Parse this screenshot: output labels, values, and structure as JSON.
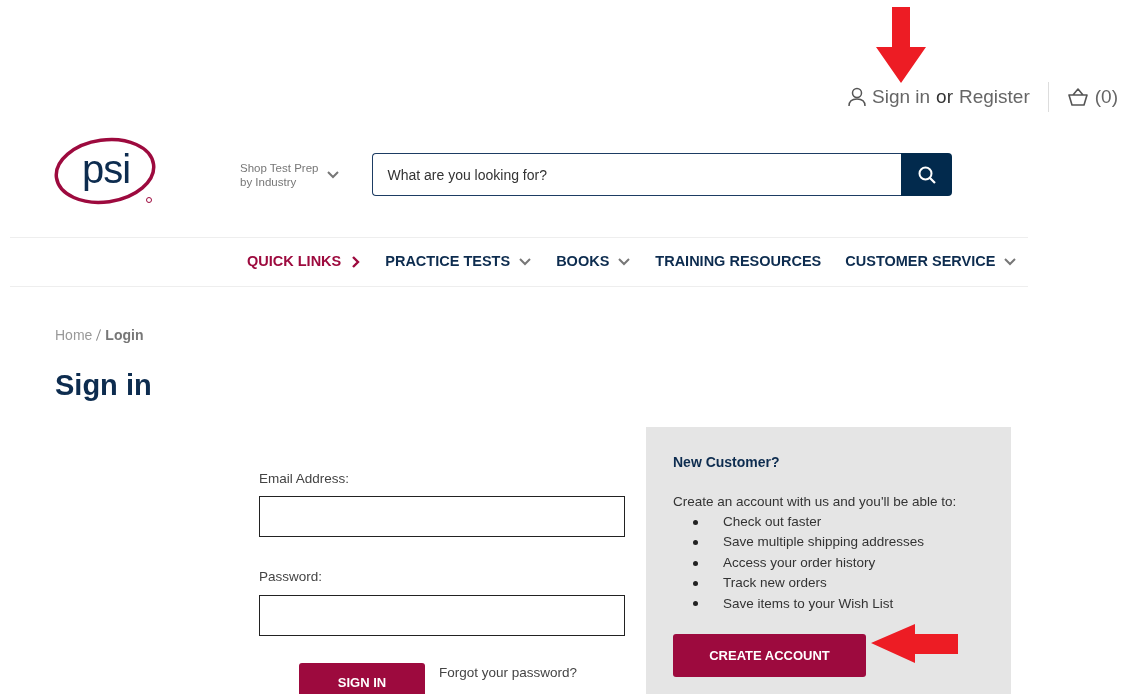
{
  "account_bar": {
    "sign_in": "Sign in",
    "or": "or",
    "register": "Register",
    "cart": "(0)"
  },
  "header": {
    "logo": "psi",
    "shop_menu": [
      "Shop Test Prep",
      "by Industry"
    ],
    "search": {
      "placeholder": "What are you looking for?"
    }
  },
  "nav": [
    {
      "label": "QUICK LINKS",
      "highlighted": true,
      "kind": "more"
    },
    {
      "label": "PRACTICE TESTS",
      "highlighted": false,
      "kind": "dropdown"
    },
    {
      "label": "BOOKS",
      "highlighted": false,
      "kind": "dropdown"
    },
    {
      "label": "TRAINING RESOURCES",
      "highlighted": false,
      "kind": "link"
    },
    {
      "label": "CUSTOMER SERVICE",
      "highlighted": false,
      "kind": "dropdown"
    }
  ],
  "breadcrumb": [
    {
      "label": "Home",
      "current": false
    },
    {
      "label": "Login",
      "current": true
    }
  ],
  "title": "Sign in",
  "login_form": {
    "fields": [
      {
        "label": "Email Address:"
      },
      {
        "label": "Password:"
      }
    ],
    "submit": "SIGN IN",
    "forgot": "Forgot your password?"
  },
  "new_customer": {
    "heading": "New Customer?",
    "intro": "Create an account with us and you'll be able to:",
    "benefits": [
      "Check out faster",
      "Save multiple shipping addresses",
      "Access your order history",
      "Track new orders",
      "Save items to your Wish List"
    ],
    "button": "CREATE ACCOUNT"
  },
  "annotations": [
    {
      "kind": "arrow_down"
    },
    {
      "kind": "arrow_left"
    }
  ]
}
